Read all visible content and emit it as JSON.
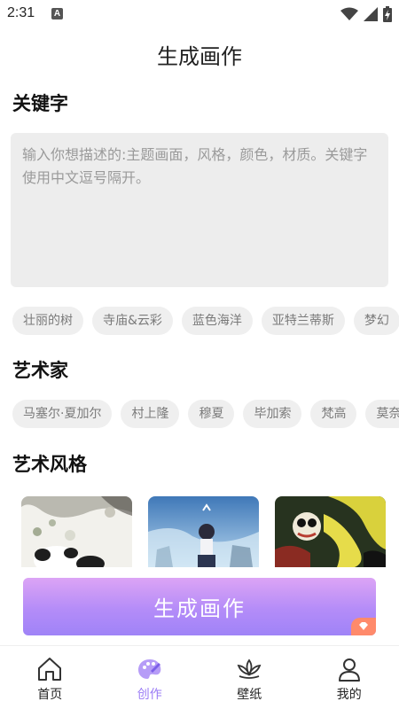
{
  "status_bar": {
    "time": "2:31",
    "notification_icon_letter": "A",
    "icons": [
      "wifi-icon",
      "signal-icon",
      "battery-charging-icon"
    ]
  },
  "page": {
    "title": "生成画作"
  },
  "keywords": {
    "heading": "关键字",
    "placeholder": "输入你想描述的:主题画面，风格，颜色，材质。关键字使用中文逗号隔开。",
    "suggestions": [
      "壮丽的树",
      "寺庙&云彩",
      "蓝色海洋",
      "亚特兰蒂斯",
      "梦幻"
    ]
  },
  "artists": {
    "heading": "艺术家",
    "items": [
      "马塞尔·夏加尔",
      "村上隆",
      "穆夏",
      "毕加索",
      "梵高",
      "莫奈"
    ]
  },
  "styles": {
    "heading": "艺术风格",
    "items": [
      {
        "name": "ink-panda",
        "palette": [
          "#f4f4f2",
          "#3a3a3a",
          "#6b7b55"
        ]
      },
      {
        "name": "anime-sky",
        "palette": [
          "#7fb6e6",
          "#3f6fa8",
          "#d9e9f5"
        ]
      },
      {
        "name": "psychedelic",
        "palette": [
          "#1f2a1c",
          "#d8d23a",
          "#c84a3a"
        ]
      }
    ]
  },
  "actions": {
    "generate_label": "生成画作"
  },
  "bottom_nav": {
    "items": [
      {
        "label": "首页",
        "icon": "home-icon",
        "active": false
      },
      {
        "label": "创作",
        "icon": "palette-icon",
        "active": true
      },
      {
        "label": "壁纸",
        "icon": "lotus-icon",
        "active": false
      },
      {
        "label": "我的",
        "icon": "user-icon",
        "active": false
      }
    ]
  },
  "colors": {
    "accent": "#9a7bf5",
    "button_gradient_top": "#dca4f5",
    "button_gradient_bottom": "#9f83f7",
    "chip_bg": "#efefef",
    "input_bg": "#ededed",
    "vip_badge": "#ff8a6b"
  }
}
